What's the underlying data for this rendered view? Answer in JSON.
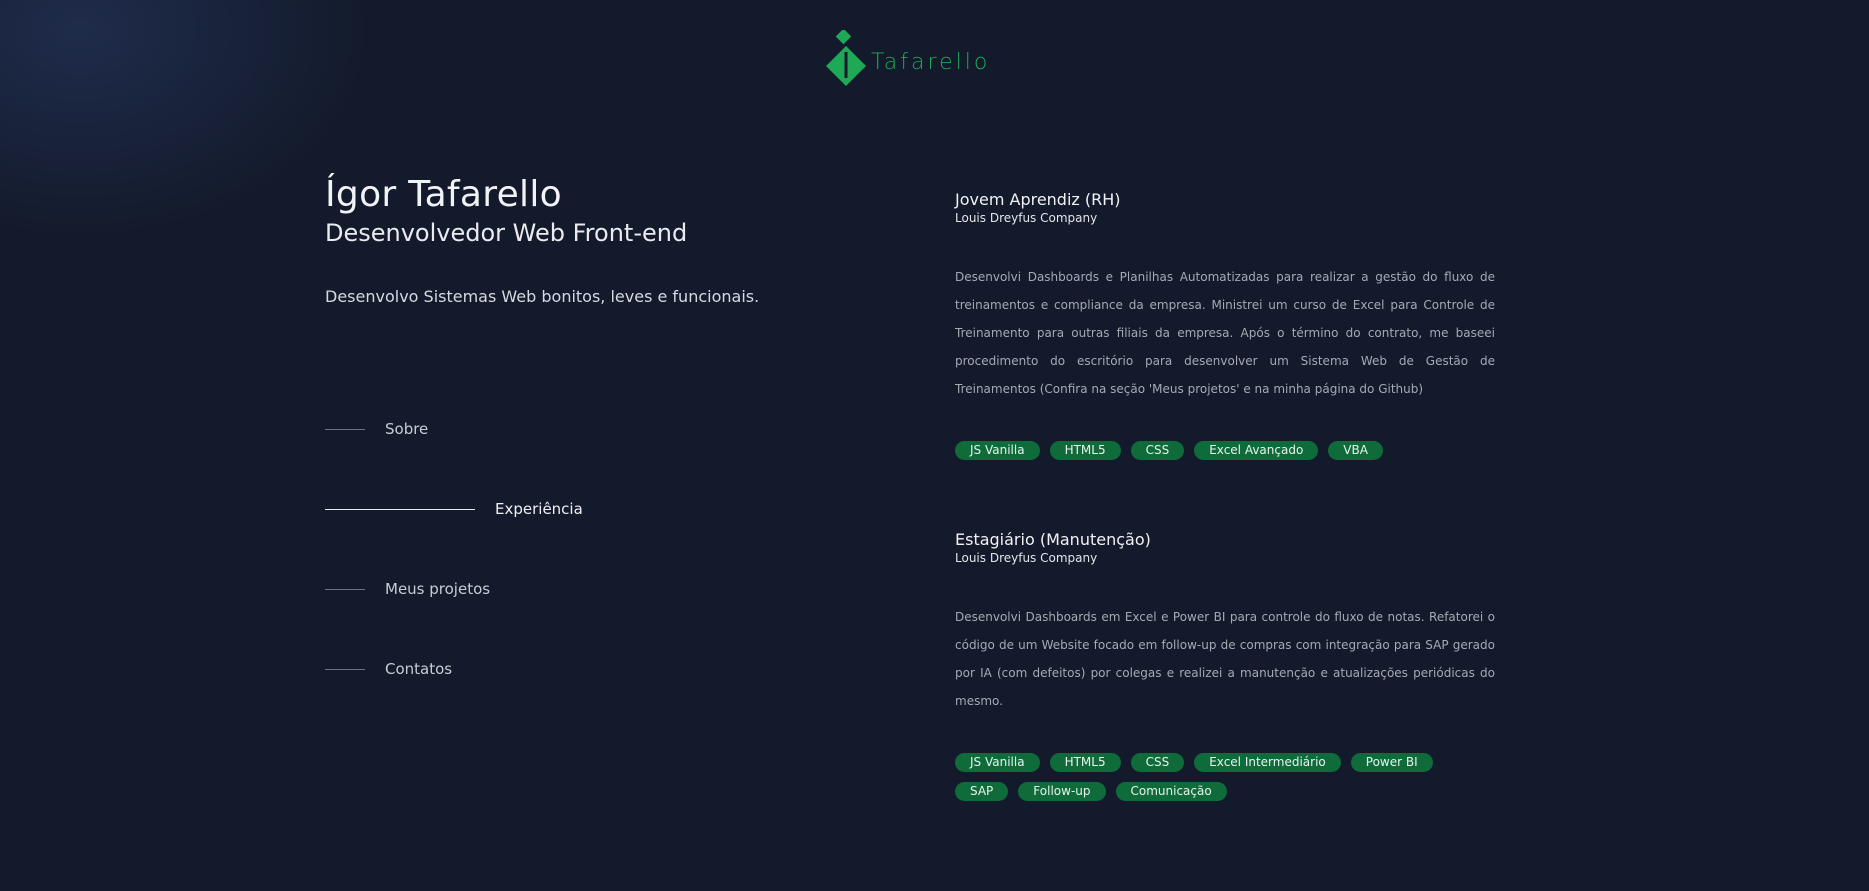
{
  "logo": {
    "text": "Tafarello",
    "color": "#1fa855"
  },
  "hero": {
    "name": "Ígor Tafarello",
    "role": "Desenvolvedor Web Front-end",
    "tagline": "Desenvolvo Sistemas Web bonitos, leves e funcionais."
  },
  "nav": {
    "items": [
      {
        "label": "Sobre",
        "active": false
      },
      {
        "label": "Experiência",
        "active": true
      },
      {
        "label": "Meus projetos",
        "active": false
      },
      {
        "label": "Contatos",
        "active": false
      }
    ]
  },
  "experiences": [
    {
      "title": "Jovem Aprendiz (RH)",
      "company": "Louis Dreyfus Company",
      "description": "Desenvolvi Dashboards e Planilhas Automatizadas para realizar a gestão do fluxo de treinamentos e compliance da empresa. Ministrei um curso de Excel para Controle de Treinamento para outras filiais da empresa. Após o término do contrato, me baseei procedimento do escritório para desenvolver um Sistema Web de Gestão de Treinamentos (Confira na seção 'Meus projetos' e na minha página do Github)",
      "tags": [
        "JS Vanilla",
        "HTML5",
        "CSS",
        "Excel Avançado",
        "VBA"
      ]
    },
    {
      "title": "Estagiário (Manutenção)",
      "company": "Louis Dreyfus Company",
      "description": "Desenvolvi Dashboards em Excel e Power BI para controle do fluxo de notas. Refatorei o código de um Website focado em follow-up de compras com integração para SAP gerado por IA (com defeitos) por colegas e realizei a manutenção e atualizações periódicas do mesmo.",
      "tags": [
        "JS Vanilla",
        "HTML5",
        "CSS",
        "Excel Intermediário",
        "Power BI",
        "SAP",
        "Follow-up",
        "Comunicação"
      ]
    }
  ],
  "colors": {
    "background": "#131a2b",
    "accent": "#1fa855",
    "tag_bg": "#0f6b3a"
  }
}
